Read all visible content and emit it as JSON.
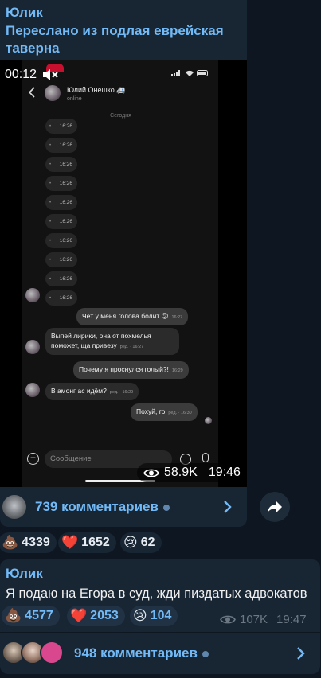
{
  "message1": {
    "sender": "Юлик",
    "forwarded_from": "Переслано из подлая еврейская таверна",
    "video": {
      "duration": "00:12",
      "views": "58.9K",
      "time": "19:46",
      "inner_chat": {
        "contact_name": "Юлий Онешко 🚑",
        "contact_status": "online",
        "date_divider": "Сегодня",
        "timestamps": [
          "16:26",
          "16:26",
          "16:26",
          "16:26",
          "16:26",
          "16:26",
          "16:26",
          "16:26",
          "16:26",
          "16:26"
        ],
        "messages": [
          {
            "text": "Чёт у меня голова болит 😕",
            "time": "16:27"
          },
          {
            "text": "Выпей лирики, она от похмелья поможет, ща привезу",
            "time": "ред. · 16:27"
          },
          {
            "text": "Почему я проснулся голый?!",
            "time": "16:29"
          },
          {
            "text": "В амонг ас идём?",
            "time": "ред. · 16:29"
          },
          {
            "text": "Похуй, го",
            "time": "ред. · 16:30"
          }
        ],
        "input_placeholder": "Сообщение"
      }
    },
    "comments_label": "739 комментариев",
    "reactions": [
      {
        "emoji": "💩",
        "count": "4339"
      },
      {
        "emoji": "❤️",
        "count": "1652"
      },
      {
        "emoji": "😢",
        "count": "62"
      }
    ]
  },
  "message2": {
    "sender": "Юлик",
    "text": "Я подаю на Егора в суд, жди пиздатых адвокатов",
    "reactions": [
      {
        "emoji": "💩",
        "count": "4577"
      },
      {
        "emoji": "❤️",
        "count": "2053"
      },
      {
        "emoji": "😢",
        "count": "104"
      }
    ],
    "views": "107K",
    "time": "19:47",
    "comments_label": "948 комментариев"
  },
  "colors": {
    "background": "#0e1621",
    "bubble": "#182533",
    "accent": "#71baf7"
  }
}
